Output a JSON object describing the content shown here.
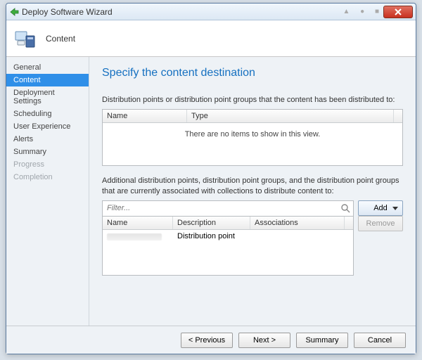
{
  "window_title": "Deploy Software Wizard",
  "header_label": "Content",
  "sidebar": {
    "items": [
      {
        "label": "General"
      },
      {
        "label": "Content"
      },
      {
        "label": "Deployment Settings"
      },
      {
        "label": "Scheduling"
      },
      {
        "label": "User Experience"
      },
      {
        "label": "Alerts"
      },
      {
        "label": "Summary"
      },
      {
        "label": "Progress"
      },
      {
        "label": "Completion"
      }
    ],
    "selected_index": 1,
    "disabled_from_index": 7
  },
  "main": {
    "heading": "Specify the content destination",
    "desc1": "Distribution points or distribution point groups that the content has been distributed to:",
    "grid1": {
      "columns": [
        "Name",
        "Type"
      ],
      "empty_text": "There are no items to show in this view."
    },
    "desc2": "Additional distribution points, distribution point groups, and the distribution point groups that are currently associated with collections to distribute content to:",
    "filter_placeholder": "Filter...",
    "add_label": "Add",
    "remove_label": "Remove",
    "grid2": {
      "columns": [
        "Name",
        "Description",
        "Associations"
      ],
      "rows": [
        {
          "name": "",
          "description": "Distribution point",
          "associations": ""
        }
      ]
    }
  },
  "footer": {
    "previous": "< Previous",
    "next": "Next >",
    "summary": "Summary",
    "cancel": "Cancel"
  }
}
